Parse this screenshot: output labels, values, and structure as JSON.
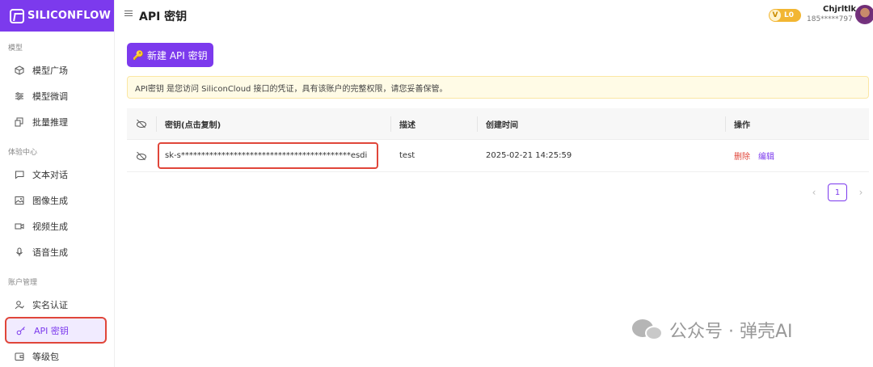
{
  "brand": {
    "name": "SILICONFLOW"
  },
  "sidebar": {
    "sections": [
      {
        "label": "模型"
      },
      {
        "label": "体验中心"
      },
      {
        "label": "账户管理"
      }
    ],
    "items": [
      {
        "label": "模型广场",
        "icon": "cube-icon"
      },
      {
        "label": "模型微调",
        "icon": "sliders-icon"
      },
      {
        "label": "批量推理",
        "icon": "batch-icon"
      },
      {
        "label": "文本对话",
        "icon": "chat-icon"
      },
      {
        "label": "图像生成",
        "icon": "image-icon"
      },
      {
        "label": "视频生成",
        "icon": "video-icon"
      },
      {
        "label": "语音生成",
        "icon": "mic-icon"
      },
      {
        "label": "实名认证",
        "icon": "user-check-icon"
      },
      {
        "label": "API 密钥",
        "icon": "key-icon",
        "active": true
      },
      {
        "label": "等级包",
        "icon": "wallet-icon"
      }
    ]
  },
  "header": {
    "title": "API 密钥",
    "level": {
      "badge": "V",
      "label": "L0"
    },
    "user": {
      "name": "Chjrltlk",
      "phone": "185*****797"
    }
  },
  "main": {
    "new_key_button": "新建 API 密钥",
    "notice": "API密钥 是您访问 SiliconCloud 接口的凭证，具有该账户的完整权限，请您妥善保管。",
    "table": {
      "headers": [
        "密钥(点击复制)",
        "描述",
        "创建时间",
        "操作"
      ],
      "rows": [
        {
          "key": "sk-s******************************************esdi",
          "description": "test",
          "created": "2025-02-21 14:25:59",
          "actions": [
            "删除",
            "编辑"
          ]
        }
      ]
    },
    "pagination": {
      "prev": "‹",
      "current": "1",
      "next": "›"
    }
  },
  "watermark": {
    "text": "公众号 · 弹壳AI"
  },
  "colors": {
    "accent": "#7c3aed",
    "danger": "#e0463a",
    "notice_bg": "#fffbe6",
    "level": "#f2b632"
  }
}
